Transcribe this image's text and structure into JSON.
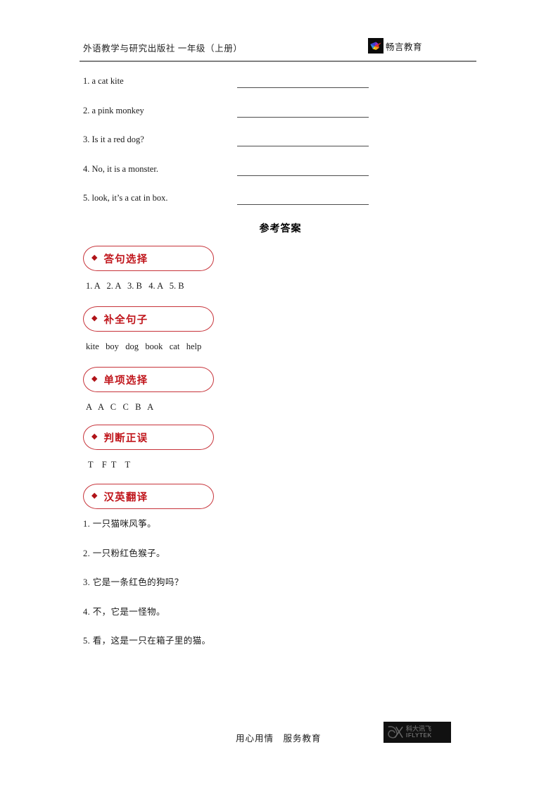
{
  "header": {
    "title": "外语教学与研究出版社  一年级（上册）",
    "brand_name": "畅言教育",
    "brand_logo_icon": "bird-logo-icon"
  },
  "exercises": {
    "items": [
      {
        "text": "1. a cat kite"
      },
      {
        "text": "2. a pink monkey"
      },
      {
        "text": "3. Is it a red dog?"
      },
      {
        "text": "4. No, it is a monster."
      },
      {
        "text": "5. look, it’s a cat in box."
      }
    ]
  },
  "answers_title": "参考答案",
  "sections": [
    {
      "bullet": "◆",
      "label": "答句选择",
      "answer": "1. A   2. A   3. B   4. A   5. B"
    },
    {
      "bullet": "◆",
      "label": "补全句子",
      "answer": "kite   boy   dog   book   cat   help"
    },
    {
      "bullet": "◆",
      "label": "单项选择",
      "answer": "A   A   C   C   B   A"
    },
    {
      "bullet": "◆",
      "label": "判断正误",
      "answer": " T    F  T    T"
    },
    {
      "bullet": "◆",
      "label": "汉英翻译",
      "answer": ""
    }
  ],
  "translations": {
    "items": [
      {
        "text": "1. 一只猫咪风筝。"
      },
      {
        "text": "2. 一只粉红色猴子。"
      },
      {
        "text": "3. 它是一条红色的狗吗？"
      },
      {
        "text": "4. 不，它是一怪物。"
      },
      {
        "text": "5. 看，这是一只在箱子里的猫。"
      }
    ]
  },
  "footer": {
    "slogan": "用心用情　服务教育",
    "logo_cn": "科大讯飞",
    "logo_en": "IFLYTEK",
    "logo_icon": "iflytek-logo-icon"
  },
  "colors": {
    "section_border": "#c7333a",
    "section_label": "#c0151b",
    "rule": "#808080"
  }
}
